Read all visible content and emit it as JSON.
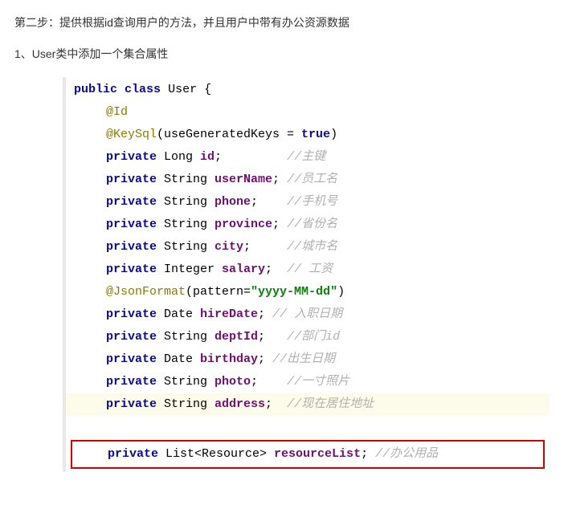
{
  "heading": "第二步：提供根据id查询用户的方法，并且用户中带有办公资源数据",
  "sub": "1、User类中添加一个集合属性",
  "code": {
    "l0": {
      "kw1": "public",
      "kw2": "class",
      "name": "User",
      "brace": " {"
    },
    "l1": {
      "ann": "@Id"
    },
    "l2": {
      "ann": "@KeySql",
      "open": "(useGeneratedKeys = ",
      "val": "true",
      "close": ")"
    },
    "l3": {
      "kw": "private",
      "type": " Long ",
      "name": "id",
      "semi": ";",
      "cmt": "//主键"
    },
    "l4": {
      "kw": "private",
      "type": " String ",
      "name": "userName",
      "semi": ";",
      "cmt": "//员工名"
    },
    "l5": {
      "kw": "private",
      "type": " String ",
      "name": "phone",
      "semi": ";",
      "cmt": "//手机号"
    },
    "l6": {
      "kw": "private",
      "type": " String ",
      "name": "province",
      "semi": ";",
      "cmt": "//省份名"
    },
    "l7": {
      "kw": "private",
      "type": " String ",
      "name": "city",
      "semi": ";",
      "cmt": "//城市名"
    },
    "l8": {
      "kw": "private",
      "type": " Integer ",
      "name": "salary",
      "semi": ";",
      "cmt": "// 工资"
    },
    "l9": {
      "ann": "@JsonFormat",
      "open": "(pattern=",
      "val": "\"yyyy-MM-dd\"",
      "close": ")"
    },
    "l10": {
      "kw": "private",
      "type": " Date ",
      "name": "hireDate",
      "semi": ";",
      "cmt": "// 入职日期"
    },
    "l11": {
      "kw": "private",
      "type": " String ",
      "name": "deptId",
      "semi": ";",
      "cmt": "//部门id"
    },
    "l12": {
      "kw": "private",
      "type": " Date ",
      "name": "birthday",
      "semi": ";",
      "cmt": "//出生日期"
    },
    "l13": {
      "kw": "private",
      "type": " String ",
      "name": "photo",
      "semi": ";",
      "cmt": "//一寸照片"
    },
    "l14": {
      "kw": "private",
      "type": " String ",
      "name": "address",
      "semi": ";",
      "cmt": "//现在居住地址"
    },
    "l15": {
      "kw": "private",
      "type": " List<Resource> ",
      "name": "resourceList",
      "semi": ";",
      "cmt": "//办公用品"
    }
  }
}
